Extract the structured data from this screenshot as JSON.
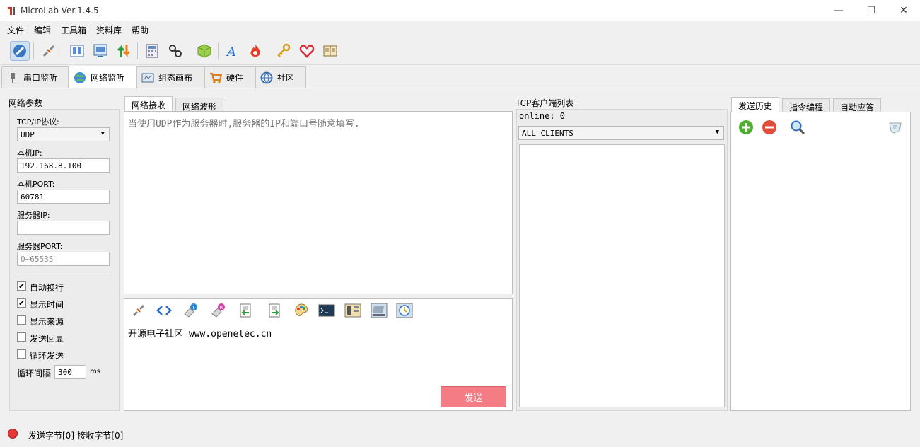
{
  "window": {
    "title": "MicroLab Ver.1.4.5",
    "minimize": "—",
    "maximize": "☐",
    "close": "✕"
  },
  "menu": [
    "文件",
    "编辑",
    "工具箱",
    "资料库",
    "帮助"
  ],
  "main_tabs": [
    {
      "label": "串口监听",
      "icon": "plug-icon"
    },
    {
      "label": "网络监听",
      "icon": "globe-icon"
    },
    {
      "label": "组态画布",
      "icon": "canvas-icon"
    },
    {
      "label": "硬件",
      "icon": "cart-icon"
    },
    {
      "label": "社区",
      "icon": "community-icon"
    }
  ],
  "net_params": {
    "section_title": "网络参数",
    "protocol_label": "TCP/IP协议:",
    "protocol_value": "UDP",
    "local_ip_label": "本机IP:",
    "local_ip_value": "192.168.8.100",
    "local_port_label": "本机PORT:",
    "local_port_value": "60781",
    "server_ip_label": "服务器IP:",
    "server_ip_value": "",
    "server_port_label": "服务器PORT:",
    "server_port_placeholder": "0~65535",
    "checkboxes": [
      {
        "label": "自动换行",
        "checked": true
      },
      {
        "label": "显示时间",
        "checked": true
      },
      {
        "label": "显示来源",
        "checked": false
      },
      {
        "label": "发送回显",
        "checked": false
      },
      {
        "label": "循环发送",
        "checked": false
      }
    ],
    "interval_label": "循环间隔",
    "interval_value": "300",
    "interval_unit": "ms"
  },
  "receive": {
    "tabs": [
      "网络接收",
      "网络波形"
    ],
    "hint": "当使用UDP作为服务器时,服务器的IP和端口号随意填写."
  },
  "send": {
    "text": "开源电子社区 www.openelec.cn",
    "button": "发送"
  },
  "clients": {
    "title": "TCP客户端列表",
    "online": "online: 0",
    "select_value": "ALL CLIENTS"
  },
  "right_panel": {
    "tabs": [
      "发送历史",
      "指令编程",
      "自动应答"
    ]
  },
  "status": {
    "text": "发送字节[0]-接收字节[0]",
    "led_color": "#e53935"
  }
}
